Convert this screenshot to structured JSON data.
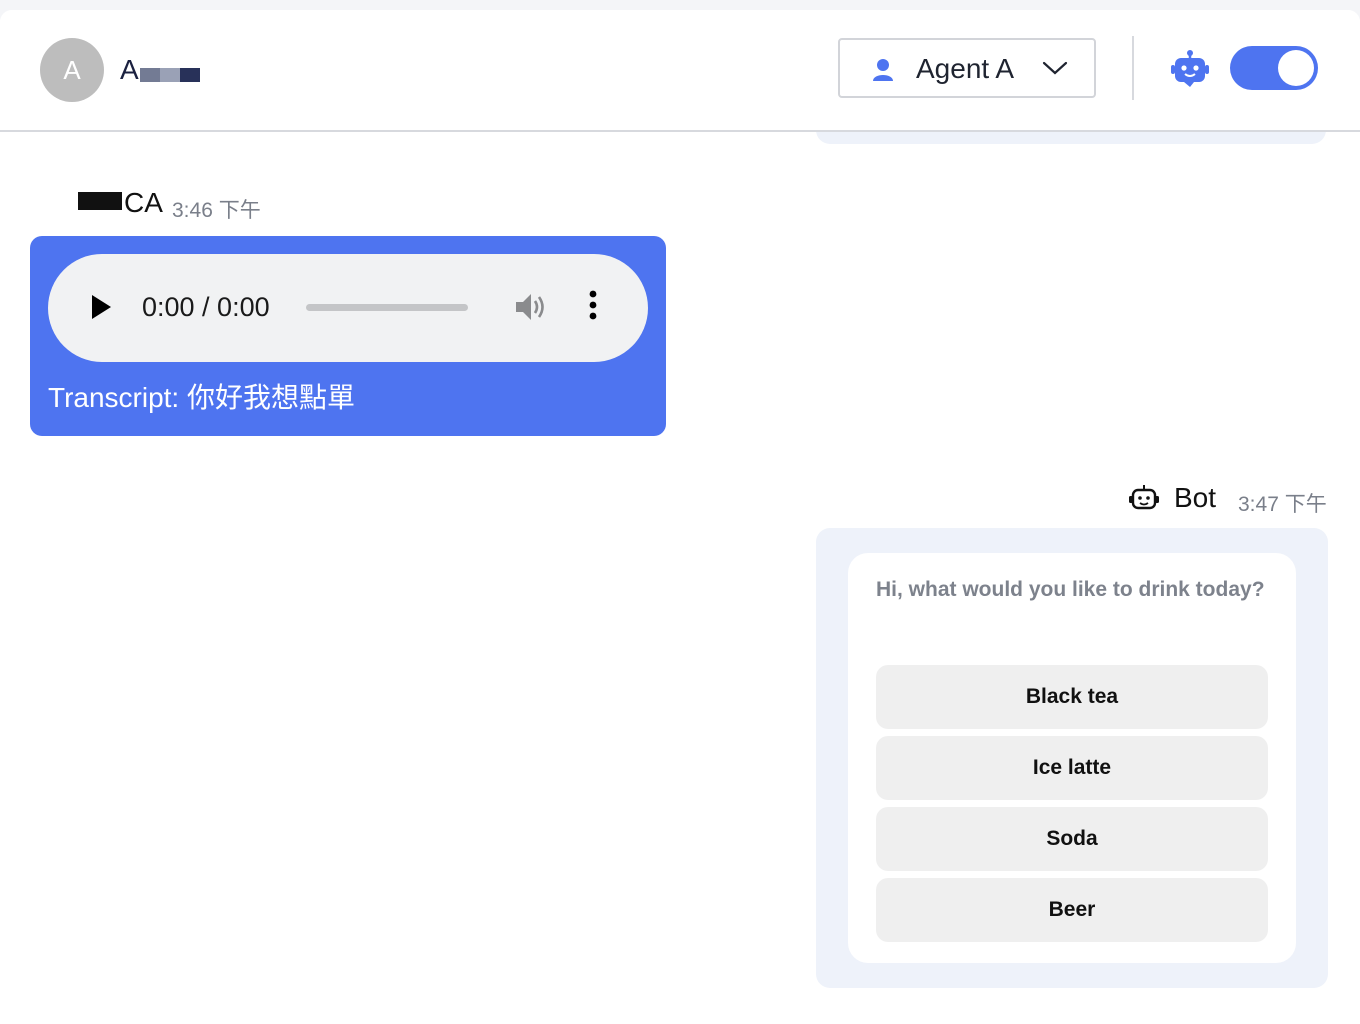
{
  "header": {
    "avatar_letter": "A",
    "user_name": "A",
    "agent_select": {
      "selected": "Agent A"
    },
    "bot_toggle": {
      "state": "on"
    },
    "accent_color": "#4e74f0"
  },
  "messages": {
    "user": {
      "sender": "CA",
      "time": "3:46 下午",
      "audio": {
        "time_display": "0:00 / 0:00"
      },
      "transcript": "Transcript: 你好我想點單"
    },
    "bot": {
      "sender": "Bot",
      "time": "3:47 下午",
      "question": "Hi, what would you like to drink today?",
      "options": [
        "Black tea",
        "Ice latte",
        "Soda",
        "Beer"
      ]
    }
  }
}
